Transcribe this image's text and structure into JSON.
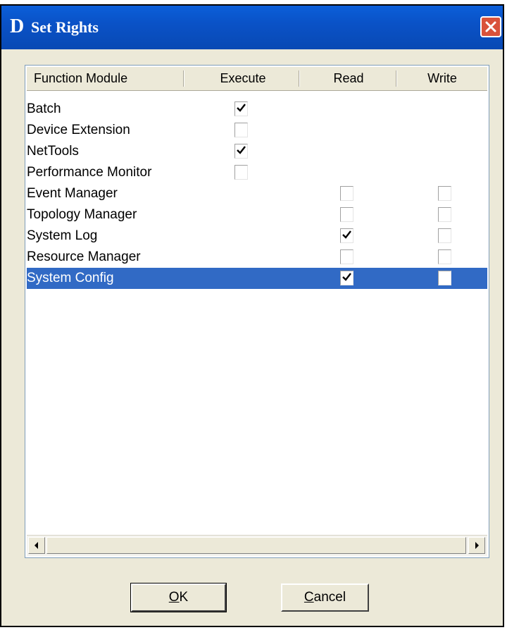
{
  "window": {
    "logo": "D",
    "title": "Set Rights"
  },
  "columns": [
    "Function Module",
    "Execute",
    "Read",
    "Write"
  ],
  "rows": [
    {
      "name": "Batch",
      "execute": true,
      "read": null,
      "write": null,
      "selected": false
    },
    {
      "name": "Device Extension",
      "execute": false,
      "read": null,
      "write": null,
      "selected": false
    },
    {
      "name": "NetTools",
      "execute": true,
      "read": null,
      "write": null,
      "selected": false
    },
    {
      "name": "Performance Monitor",
      "execute": false,
      "read": null,
      "write": null,
      "selected": false
    },
    {
      "name": "Event Manager",
      "execute": null,
      "read": false,
      "write": false,
      "selected": false
    },
    {
      "name": "Topology Manager",
      "execute": null,
      "read": false,
      "write": false,
      "selected": false
    },
    {
      "name": "System Log",
      "execute": null,
      "read": true,
      "write": false,
      "selected": false
    },
    {
      "name": "Resource Manager",
      "execute": null,
      "read": false,
      "write": false,
      "selected": false
    },
    {
      "name": "System Config",
      "execute": null,
      "read": true,
      "write": false,
      "selected": true
    }
  ],
  "buttons": {
    "ok": {
      "mnemonic": "O",
      "rest": "K"
    },
    "cancel": {
      "mnemonic": "C",
      "rest": "ancel"
    }
  },
  "icons": {
    "close": "close-icon",
    "scroll_left": "arrow-left-icon",
    "scroll_right": "arrow-right-icon",
    "check": "checkmark-icon"
  },
  "colors": {
    "titlebar": "#0a52c7",
    "selection": "#316ac5",
    "close": "#d9523b",
    "dialog_bg": "#ece9d8"
  }
}
